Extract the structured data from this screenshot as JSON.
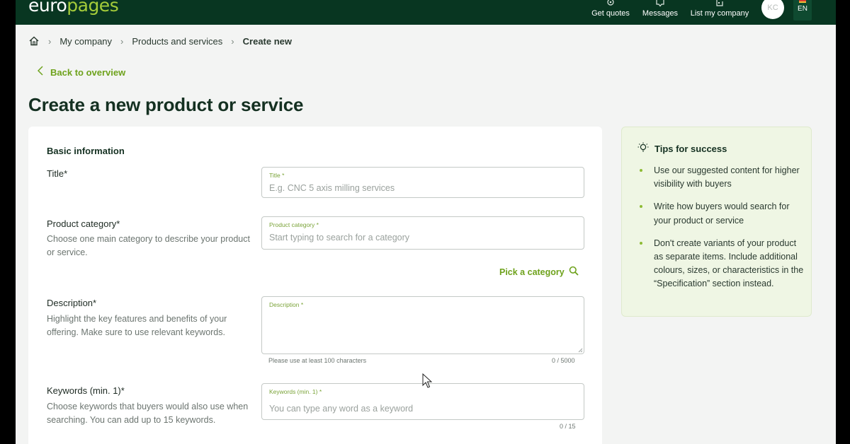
{
  "header": {
    "logo_main": "euro",
    "logo_accent": "pages",
    "nav": [
      {
        "label": "Get quotes",
        "icon": "quote-icon"
      },
      {
        "label": "Messages",
        "icon": "messages-icon"
      },
      {
        "label": "List my company",
        "icon": "company-icon"
      }
    ],
    "avatar_initials": "KC",
    "language": "EN"
  },
  "breadcrumb": {
    "home_icon": "home-icon",
    "items": [
      "My company",
      "Products and services",
      "Create new"
    ]
  },
  "back_link": "Back to overview",
  "page_title": "Create a new product or service",
  "form": {
    "section_title": "Basic information",
    "title": {
      "label": "Title*",
      "input_label": "Title *",
      "placeholder": "E.g. CNC 5 axis milling services"
    },
    "category": {
      "label": "Product category*",
      "help": "Choose one main category to describe your product or service.",
      "input_label": "Product category *",
      "placeholder": "Start typing to search for a category",
      "pick_label": "Pick a category"
    },
    "description": {
      "label": "Description*",
      "help": "Highlight the key features and benefits of your offering. Make sure to use relevant keywords.",
      "input_label": "Description *",
      "hint": "Please use at least 100 characters",
      "counter": "0 / 5000"
    },
    "keywords": {
      "label": "Keywords (min. 1)*",
      "help": "Choose keywords that buyers would also use when searching. You can add up to 15 keywords.",
      "input_label": "Keywords (min. 1) *",
      "placeholder": "You can type any word as a keyword",
      "counter": "0 / 15"
    }
  },
  "tips": {
    "title": "Tips for success",
    "items": [
      "Use our suggested content for higher visibility with buyers",
      "Write how buyers would search for your product or service",
      "Don't create variants of your product as separate items. Include additional colours, sizes, or characteristics in the “Specification” section instead."
    ]
  },
  "colors": {
    "header_bg": "#083621",
    "accent_green": "#6ea21c",
    "tips_bg": "#eff6e4"
  }
}
